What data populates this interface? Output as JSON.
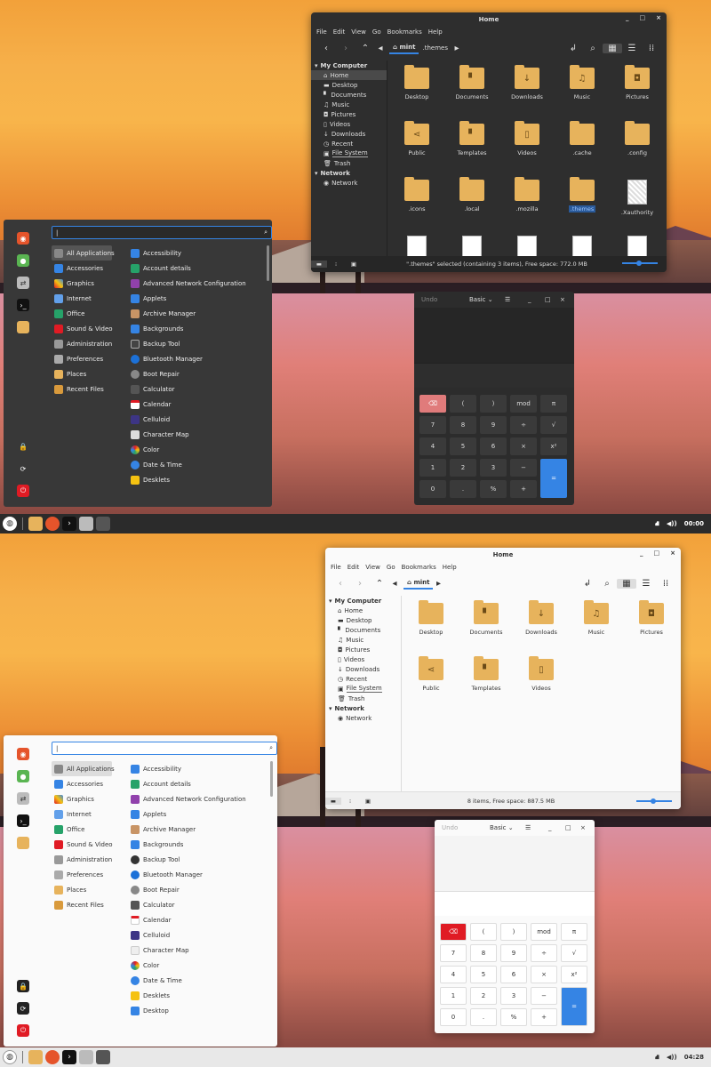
{
  "panel": {
    "dark_clock": "00:00",
    "light_clock": "04:28",
    "start_icon": "mint-logo-icon",
    "launchers": [
      "folder-icon",
      "firefox-icon",
      "terminal-icon",
      "toggle-icon",
      "calculator-icon"
    ]
  },
  "file_manager": {
    "title": "Home",
    "controls": [
      "_",
      "□",
      "×"
    ],
    "menus": [
      "File",
      "Edit",
      "View",
      "Go",
      "Bookmarks",
      "Help"
    ],
    "breadcrumb_dark": [
      "mint",
      ".themes"
    ],
    "breadcrumb_light": [
      "mint"
    ],
    "sidebar": {
      "my_computer": "My Computer",
      "items": [
        "Home",
        "Desktop",
        "Documents",
        "Music",
        "Pictures",
        "Videos",
        "Downloads",
        "Recent",
        "File System",
        "Trash"
      ],
      "network_head": "Network",
      "network_items": [
        "Network"
      ]
    },
    "dark_items": [
      "Desktop",
      "Documents",
      "Downloads",
      "Music",
      "Pictures",
      "Public",
      "Templates",
      "Videos",
      ".cache",
      ".config",
      ".icons",
      ".local",
      ".mozilla",
      ".themes",
      ".Xauthority"
    ],
    "light_items": [
      "Desktop",
      "Documents",
      "Downloads",
      "Music",
      "Pictures",
      "Public",
      "Templates",
      "Videos"
    ],
    "dark_status": "\".themes\" selected (containing 3 items), Free space: 772.0 MB",
    "light_status": "8 items, Free space: 887.5 MB"
  },
  "menu": {
    "search_value": "|",
    "categories": [
      "All Applications",
      "Accessories",
      "Graphics",
      "Internet",
      "Office",
      "Sound & Video",
      "Administration",
      "Preferences",
      "Places",
      "Recent Files"
    ],
    "apps_dark": [
      "Accessibility",
      "Account details",
      "Advanced Network Configuration",
      "Applets",
      "Archive Manager",
      "Backgrounds",
      "Backup Tool",
      "Bluetooth Manager",
      "Boot Repair",
      "Calculator",
      "Calendar",
      "Celluloid",
      "Character Map",
      "Color",
      "Date & Time",
      "Desklets"
    ],
    "apps_light": [
      "Accessibility",
      "Account details",
      "Advanced Network Configuration",
      "Applets",
      "Archive Manager",
      "Backgrounds",
      "Backup Tool",
      "Bluetooth Manager",
      "Boot Repair",
      "Calculator",
      "Calendar",
      "Celluloid",
      "Character Map",
      "Color",
      "Date & Time",
      "Desklets",
      "Desktop"
    ]
  },
  "calculator": {
    "undo": "Undo",
    "mode": "Basic",
    "keys": [
      "⌫",
      "(",
      ")",
      "mod",
      "π",
      "7",
      "8",
      "9",
      "÷",
      "√",
      "4",
      "5",
      "6",
      "×",
      "x²",
      "1",
      "2",
      "3",
      "−",
      "=",
      "0",
      ".",
      "%",
      "+"
    ]
  },
  "colors": {
    "accent": "#3584e4",
    "folder": "#e7b35c",
    "delete_dark": "#e07b7b",
    "delete_light": "#e01b24"
  }
}
